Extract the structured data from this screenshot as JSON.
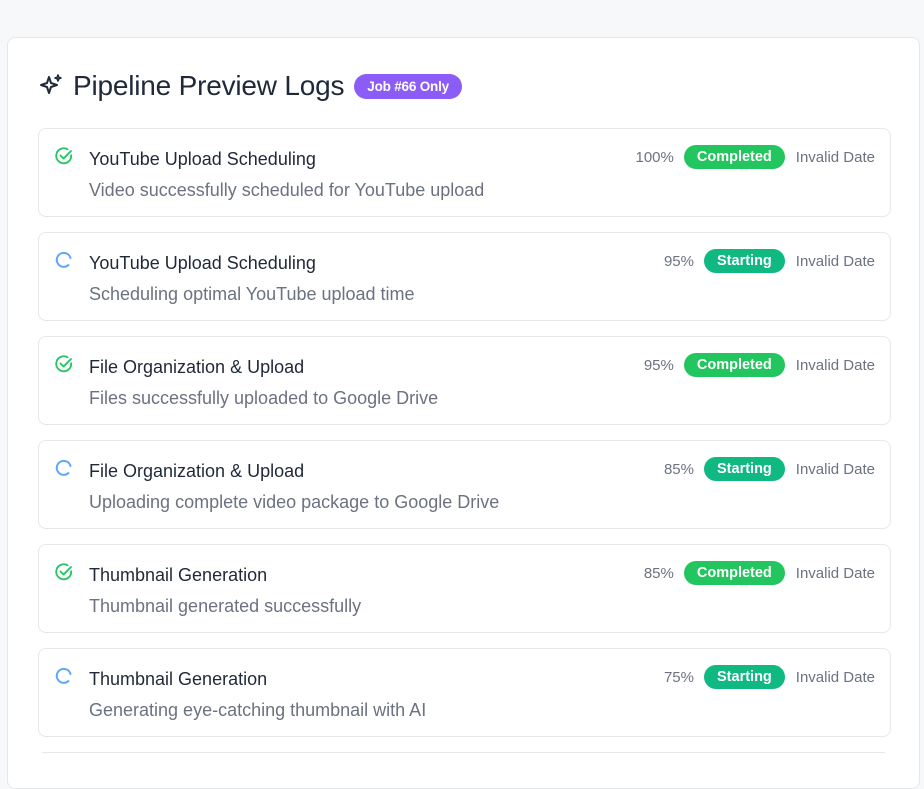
{
  "header": {
    "title": "Pipeline Preview Logs",
    "badge": "Job #66 Only",
    "icon": "sparkles-icon"
  },
  "colors": {
    "completed": "#22c55e",
    "starting": "#10b981",
    "badge": "#8b5cf6",
    "spinner": "#60a5fa"
  },
  "logs": [
    {
      "title": "YouTube Upload Scheduling",
      "message": "Video successfully scheduled for YouTube upload",
      "percent": "100%",
      "status": "Completed",
      "date": "Invalid Date",
      "icon": "check-circle-icon"
    },
    {
      "title": "YouTube Upload Scheduling",
      "message": "Scheduling optimal YouTube upload time",
      "percent": "95%",
      "status": "Starting",
      "date": "Invalid Date",
      "icon": "spinner-icon"
    },
    {
      "title": "File Organization & Upload",
      "message": "Files successfully uploaded to Google Drive",
      "percent": "95%",
      "status": "Completed",
      "date": "Invalid Date",
      "icon": "check-circle-icon"
    },
    {
      "title": "File Organization & Upload",
      "message": "Uploading complete video package to Google Drive",
      "percent": "85%",
      "status": "Starting",
      "date": "Invalid Date",
      "icon": "spinner-icon"
    },
    {
      "title": "Thumbnail Generation",
      "message": "Thumbnail generated successfully",
      "percent": "85%",
      "status": "Completed",
      "date": "Invalid Date",
      "icon": "check-circle-icon"
    },
    {
      "title": "Thumbnail Generation",
      "message": "Generating eye-catching thumbnail with AI",
      "percent": "75%",
      "status": "Starting",
      "date": "Invalid Date",
      "icon": "spinner-icon"
    }
  ]
}
